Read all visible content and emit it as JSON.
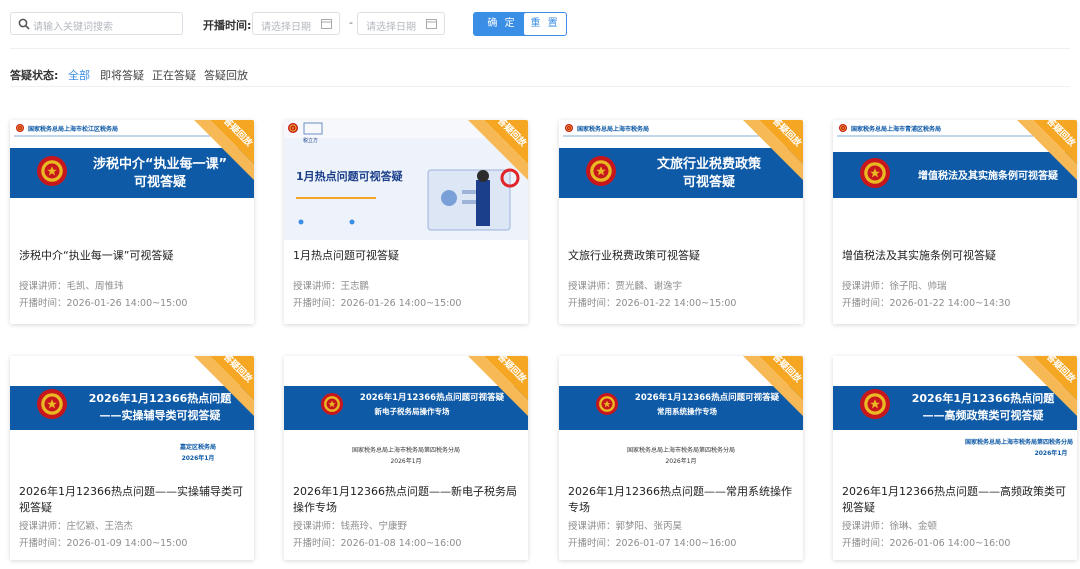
{
  "search": {
    "placeholder": "请输入关键词搜索",
    "icon": "search-icon"
  },
  "filter_time": {
    "label": "开播时间:",
    "start_placeholder": "请选择日期",
    "end_placeholder": "请选择日期",
    "separator": "-"
  },
  "buttons": {
    "confirm": "确 定",
    "reset": "重 置"
  },
  "status_filter": {
    "label": "答疑状态:",
    "options": [
      "全部",
      "即将答疑",
      "正在答疑",
      "答疑回放"
    ],
    "active": "全部"
  },
  "colors": {
    "accent": "#3a8ee6",
    "banner_blue": "#0e5aa7",
    "ribbon": "#f5a623"
  },
  "cards": [
    {
      "badge": "答疑回放",
      "org": "国家税务总局上海市松江区税务局",
      "banner_text": [
        "涉税中介“执业每一课”",
        "可视答疑"
      ],
      "title": "涉税中介“执业每一课”可视答疑",
      "lecturer": "授课讲师：毛凯、周惟玮",
      "time": "开播时间：2026-01-26 14:00~15:00"
    },
    {
      "badge": "答疑回放",
      "org": "税立方",
      "banner_text": [
        "1月热点问题可视答疑"
      ],
      "title": "1月热点问题可视答疑",
      "lecturer": "授课讲师：王志鹏",
      "time": "开播时间：2026-01-26 14:00~15:00"
    },
    {
      "badge": "答疑回放",
      "org": "国家税务总局上海市税务局",
      "banner_text": [
        "文旅行业税费政策",
        "可视答疑"
      ],
      "title": "文旅行业税费政策可视答疑",
      "lecturer": "授课讲师：贾光麟、谢逸宇",
      "time": "开播时间：2026-01-22 14:00~15:00"
    },
    {
      "badge": "答疑回放",
      "org": "国家税务总局上海市青浦区税务局",
      "banner_text": [
        "增值税法及其实施条例可视答疑"
      ],
      "title": "增值税法及其实施条例可视答疑",
      "lecturer": "授课讲师：徐子阳、帅瑞",
      "time": "开播时间：2026-01-22 14:00~14:30"
    },
    {
      "badge": "答疑回放",
      "org": "",
      "banner_text": [
        "2026年1月12366热点问题",
        "——实操辅导类可视答疑"
      ],
      "footer_text": [
        "嘉定区税务局",
        "2026年1月"
      ],
      "title": "2026年1月12366热点问题——实操辅导类可视答疑",
      "lecturer": "授课讲师：庄忆颖、王浩杰",
      "time": "开播时间：2026-01-09 14:00~15:00"
    },
    {
      "badge": "答疑回放",
      "org": "",
      "banner_text": [
        "2026年1月12366热点问题可视答疑",
        "新电子税务局操作专场"
      ],
      "footer_text": [
        "国家税务总局上海市税务局第四税务分局",
        "2026年1月"
      ],
      "title": "2026年1月12366热点问题——新电子税务局操作专场",
      "lecturer": "授课讲师：钱燕玲、宁康野",
      "time": "开播时间：2026-01-08 14:00~16:00"
    },
    {
      "badge": "答疑回放",
      "org": "",
      "banner_text": [
        "2026年1月12366热点问题可视答疑",
        "常用系统操作专场"
      ],
      "footer_text": [
        "国家税务总局上海市税务局第四税务分局",
        "2026年1月"
      ],
      "title": "2026年1月12366热点问题——常用系统操作专场",
      "lecturer": "授课讲师：郭梦阳、张丙昊",
      "time": "开播时间：2026-01-07 14:00~16:00"
    },
    {
      "badge": "答疑回放",
      "org": "",
      "banner_text": [
        "2026年1月12366热点问题",
        "——高频政策类可视答疑"
      ],
      "footer_text": [
        "国家税务总局上海市税务局第四税务分局",
        "2026年1月"
      ],
      "title": "2026年1月12366热点问题——高频政策类可视答疑",
      "lecturer": "授课讲师：徐琳、金顿",
      "time": "开播时间：2026-01-06 14:00~16:00"
    }
  ]
}
